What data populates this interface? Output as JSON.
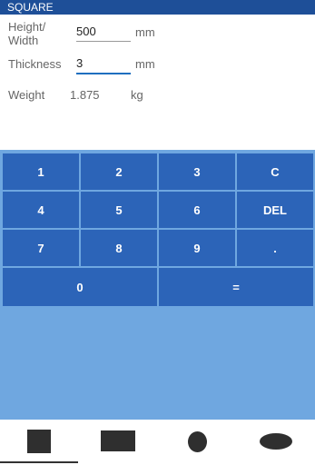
{
  "app": {
    "title": "SQUARE"
  },
  "form": {
    "height_label": "Height/\nWidth",
    "height_value": "500",
    "height_unit": "mm",
    "thickness_label": "Thickness",
    "thickness_value": "3",
    "thickness_unit": "mm",
    "weight_label": "Weight",
    "weight_value": "1.875",
    "weight_unit": "kg"
  },
  "keypad": {
    "keys": [
      "1",
      "2",
      "3",
      "C",
      "4",
      "5",
      "6",
      "DEL",
      "7",
      "8",
      "9",
      ".",
      "0",
      "="
    ]
  },
  "shapes": {
    "items": [
      "square-shape-icon",
      "rectangle-shape-icon",
      "circle-shape-icon",
      "ellipse-shape-icon"
    ],
    "selected_index": 0
  },
  "colors": {
    "titlebar": "#1e4f98",
    "key": "#2c64b8",
    "keypad_background": "#6fa7e0",
    "active_underline": "#1f6fbf"
  }
}
